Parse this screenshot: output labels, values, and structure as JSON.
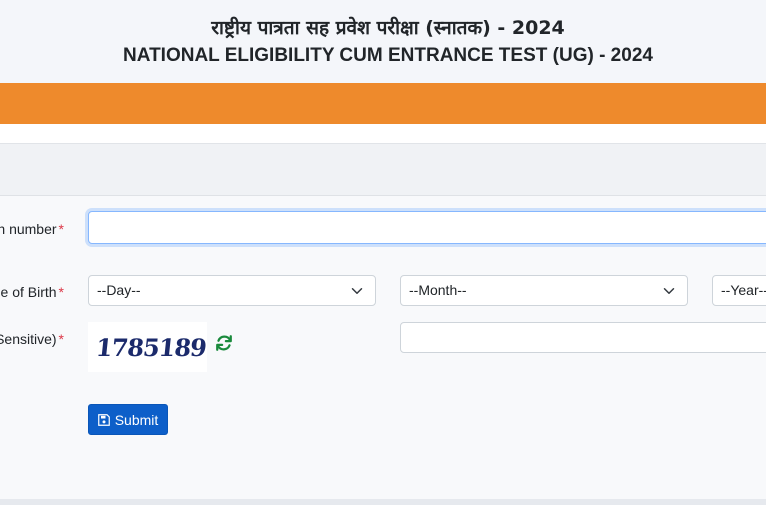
{
  "header": {
    "title_hindi": "राष्ट्रीय पात्रता सह प्रवेश परीक्षा (स्नातक) - 2024",
    "title_english": "NATIONAL ELIGIBILITY CUM ENTRANCE TEST (UG) - 2024"
  },
  "colors": {
    "accent_bar": "#ee8a2c",
    "primary_button": "#0d5fc9",
    "required_marker": "#dc3545",
    "refresh_icon": "#1a8a3c"
  },
  "form": {
    "application_number": {
      "label": "n number",
      "required_marker": "*",
      "value": ""
    },
    "dob": {
      "label": "e of Birth",
      "required_marker": "*",
      "day_selected": "--Day--",
      "month_selected": "--Month--",
      "year_selected": "--Year--"
    },
    "captcha": {
      "label": "Sensitive)",
      "required_marker": "*",
      "image_text": "1785189",
      "refresh_icon": "refresh-icon",
      "value": ""
    },
    "submit": {
      "label": "Submit",
      "icon": "save-icon"
    }
  }
}
